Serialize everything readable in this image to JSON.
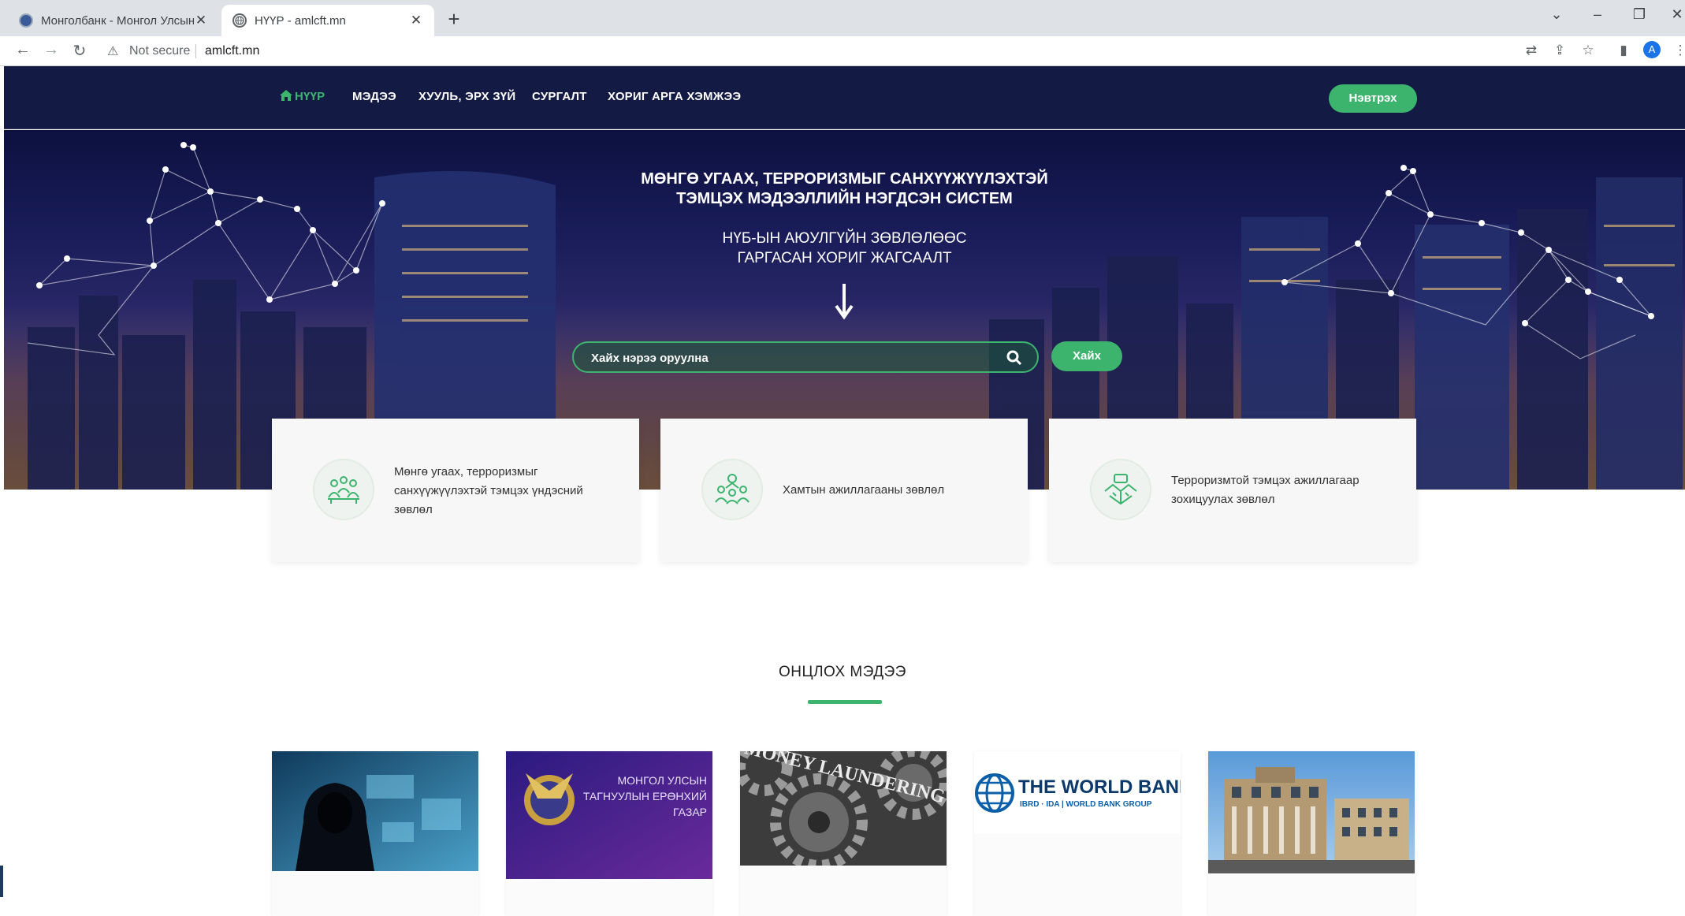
{
  "browser": {
    "tabs": [
      {
        "title": "Монголбанк - Монгол Улсын Төв"
      },
      {
        "title": "НҮҮР - amlcft.mn"
      }
    ],
    "new_tab": "+",
    "close_glyph": "✕",
    "not_secure": "Not secure",
    "url": "amlcft.mn",
    "profile_initial": "A"
  },
  "nav": {
    "items": [
      {
        "label": "НҮҮР"
      },
      {
        "label": "МЭДЭЭ"
      },
      {
        "label": "ХУУЛЬ, ЭРХ ЗҮЙ"
      },
      {
        "label": "СУРГАЛТ"
      },
      {
        "label": "ХОРИГ АРГА ХЭМЖЭЭ"
      }
    ],
    "login": "Нэвтрэх"
  },
  "hero": {
    "title_line1": "МӨНГӨ УГААХ, ТЕРРОРИЗМЫГ САНХҮҮЖҮҮЛЭХТЭЙ",
    "title_line2": "ТЭМЦЭХ МЭДЭЭЛЛИЙН НЭГДСЭН СИСТЕМ",
    "sub_line1": "НҮБ-ЫН АЮУЛГҮЙН ЗӨВЛӨЛӨӨС",
    "sub_line2": "ГАРГАСАН ХОРИГ ЖАГСААЛТ",
    "search_placeholder": "Хайх нэрээ оруулна",
    "search_button": "Хайх"
  },
  "cards": [
    {
      "line1": "Мөнгө угаах, терроризмыг",
      "line2": "санхүүжүүлэхтэй тэмцэх үндэсний",
      "line3": "зөвлөл"
    },
    {
      "line1": "Хамтын ажиллагааны зөвлөл"
    },
    {
      "line1": "Терроризмтой тэмцэх ажиллагаар",
      "line2": "зохицуулах зөвлөл"
    }
  ],
  "news_section": {
    "title": "ОНЦЛОХ МЭДЭЭ",
    "images": [
      {
        "kind": "hacker"
      },
      {
        "kind": "agency",
        "line1": "МОНГОЛ УЛСЫН",
        "line2": "ТАГНУУЛЫН ЕРӨНХИЙ",
        "line3": "ГАЗАР"
      },
      {
        "kind": "gears",
        "text": "MONEY LAUNDERING"
      },
      {
        "kind": "worldbank",
        "title": "THE WORLD BANK",
        "sub": "IBRD · IDA | WORLD BANK GROUP"
      },
      {
        "kind": "building"
      }
    ]
  },
  "colors": {
    "accent": "#3cb46e",
    "nav_bg": "#131a44"
  }
}
